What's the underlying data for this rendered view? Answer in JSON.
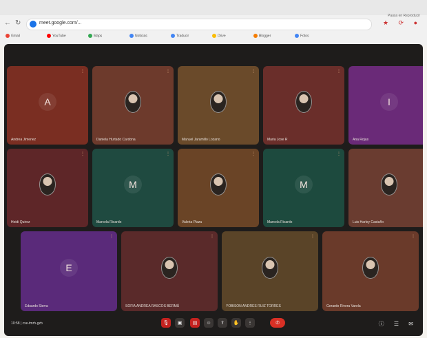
{
  "browser": {
    "url": "meet.google.com/...",
    "bookmarks": [
      "Gmail",
      "YouTube",
      "Maps",
      "Noticias",
      "Traducir",
      "Drive",
      "Blogger",
      "Fotos"
    ],
    "profile_label": "Pausa en Reproducir"
  },
  "meeting": {
    "code_label": "10:58 | cxe-tmrh-gzb",
    "participants": [
      {
        "name": "Andrea Jimenez",
        "initial": "A",
        "color": "#7a2e22"
      },
      {
        "name": "Daniela Hurtado Cardona",
        "initial": "",
        "color": "#6d3a2c"
      },
      {
        "name": "Manuel Jaramillo Lozano",
        "initial": "",
        "color": "#6a4a2a"
      },
      {
        "name": "Maria Jose R",
        "initial": "",
        "color": "#6a2e2a"
      },
      {
        "name": "Ana Rojas",
        "initial": "I",
        "color": "#6a2a78"
      },
      {
        "name": "Heidi Quiroz",
        "initial": "",
        "color": "#5e2628"
      },
      {
        "name": "Marcela Ricardo",
        "initial": "M",
        "color": "#1f4a40"
      },
      {
        "name": "Valeria Plaza",
        "initial": "",
        "color": "#6a4426"
      },
      {
        "name": "Marcela Ricardo",
        "initial": "M",
        "color": "#1d4a3e"
      },
      {
        "name": "Luis Harley Castaño",
        "initial": "",
        "color": "#6a3c30"
      },
      {
        "name": "Eduardo Sierra",
        "initial": "E",
        "color": "#5a2a7a"
      },
      {
        "name": "SOFIA ANDREA RASCOS BERMÚ",
        "initial": "",
        "color": "#5a2a2a"
      },
      {
        "name": "YOBISON ANDRES RUIZ TORRES",
        "initial": "",
        "color": "#5a4428"
      },
      {
        "name": "Gerardo Rivera Varela",
        "initial": "",
        "color": "#6a3a2a"
      }
    ]
  },
  "icons": {
    "mic": "mic-icon",
    "cam": "camera-icon",
    "cc": "captions-icon",
    "hand": "raise-hand-icon",
    "present": "present-icon",
    "more": "more-icon",
    "end": "end-call-icon"
  }
}
